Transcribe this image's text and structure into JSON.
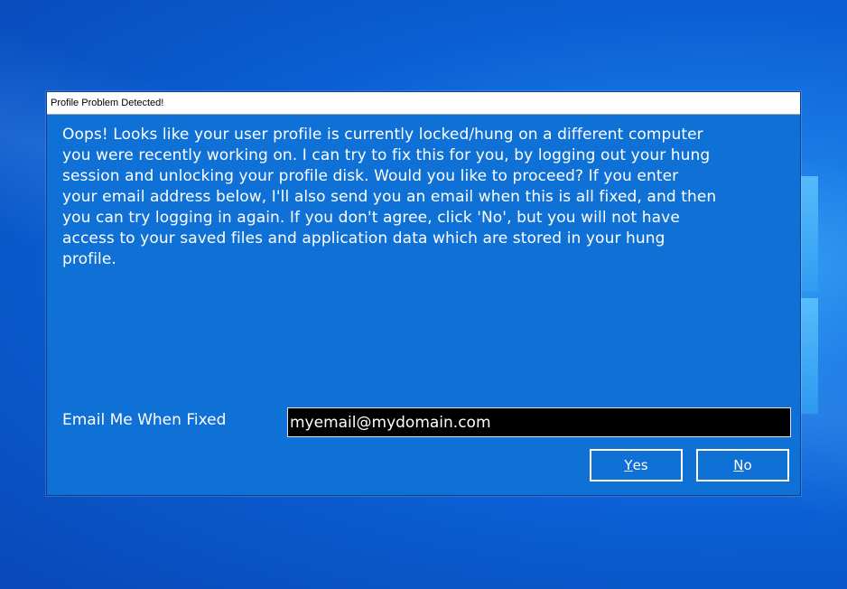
{
  "dialog": {
    "title": "Profile Problem Detected!",
    "message": "Oops!  Looks like your user profile is currently locked/hung on a different computer\nyou were recently working on.  I can try to fix this for you, by logging out your hung\nsession and unlocking your profile disk.  Would you like to proceed?  If you enter\nyour email address below, I'll also send you an email when this is all fixed, and then\nyou can try logging in again.  If you don't agree, click 'No', but you will not have\naccess to your saved files and application data which are stored in your hung\nprofile.",
    "email_label": "Email Me When Fixed",
    "email_value": "myemail@mydomain.com",
    "buttons": {
      "yes_accel": "Y",
      "yes_rest": "es",
      "no_accel": "N",
      "no_rest": "o"
    }
  },
  "colors": {
    "dialog_bg": "#0f70d6",
    "desktop_bg": "#0b5fd4",
    "input_bg": "#000000",
    "text": "#ffffff"
  }
}
